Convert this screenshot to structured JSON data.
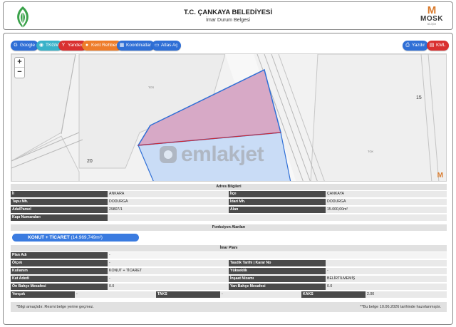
{
  "header": {
    "title": "T.C. ÇANKAYA BELEDİYESİ",
    "subtitle": "İmar Durum Belgesi",
    "brand": {
      "m": "M",
      "name": "MOSK",
      "tagline": "BİLİŞİM"
    }
  },
  "toolbar": {
    "google": "Google",
    "tkgm": "TKGM",
    "yandex": "Yandex",
    "kent_rehberi": "Kent Rehberi",
    "koordinatlar": "Koordinatlar",
    "atlas": "Atlas Aç",
    "print": "Yazdır",
    "kml": "KML"
  },
  "map": {
    "zoom_in": "+",
    "zoom_out": "−",
    "watermark": "emlakjet",
    "corner_mark": "M",
    "labels": {
      "tcs_left": "TCS",
      "block_num": "20",
      "tcs_right": "TCK",
      "road_num": "15"
    }
  },
  "address": {
    "title": "Adres Bilgileri",
    "rows": [
      {
        "l1": "İl",
        "v1": "ANKARA",
        "l2": "İlçe",
        "v2": "ÇANKAYA"
      },
      {
        "l1": "Tapu Mh.",
        "v1": "DODURGA",
        "l2": "İdari Mh.",
        "v2": "DODURGA"
      },
      {
        "l1": "Ada/Parsel",
        "v1": "29807/1",
        "l2": "Alan",
        "v2": "15.000,00m²"
      }
    ],
    "kapi_label": "Kapı Numaraları",
    "kapi_value": ""
  },
  "function_area": {
    "title": "Fonksiyon Alanları",
    "pill_name": "KONUT + TİCARET",
    "pill_area": "(14.969,749m²)"
  },
  "zoning": {
    "title": "İmar Planı",
    "plan_adi_label": "Plan Adı",
    "plan_adi_value": "-",
    "rows": [
      {
        "l1": "Ölçek",
        "v1": "-",
        "l2": "Tasdik Tarihi | Karar No",
        "v2": ""
      },
      {
        "l1": "Kullanım",
        "v1": "KONUT + TİCARET",
        "l2": "Yükseklik",
        "v2": "-"
      },
      {
        "l1": "Kat Adedi",
        "v1": "-",
        "l2": "İnşaat Nizamı",
        "v2": "BELİRTİLMEMİŞ"
      },
      {
        "l1": "Ön Bahçe Mesafesi",
        "v1": "0.0",
        "l2": "Yan Bahçe Mesafesi",
        "v2": "0.0"
      }
    ],
    "last_row": {
      "yencok_label": "Yençok",
      "yencok_value": "-",
      "taks_label": "TAKS",
      "taks_value": "-",
      "kaks_label": "KAKS",
      "kaks_value": "2.00"
    }
  },
  "footer": {
    "left": "*Bilgi amaçlıdır. Resmi belge yerine geçmez.",
    "right": "**Bu belge 10.06.2026 tarihinde hazırlanmıştır."
  },
  "colors": {
    "google": "#2f6fd6",
    "tkgm": "#38b2c9",
    "yandex": "#d93030",
    "kent_rehberi": "#ee7d2a",
    "koordinatlar": "#2f6fd6",
    "atlas": "#2f6fd6",
    "print": "#2f6fd6",
    "kml": "#d93030",
    "label_bg": "#4a4a4a",
    "pill": "#3a7be0"
  }
}
